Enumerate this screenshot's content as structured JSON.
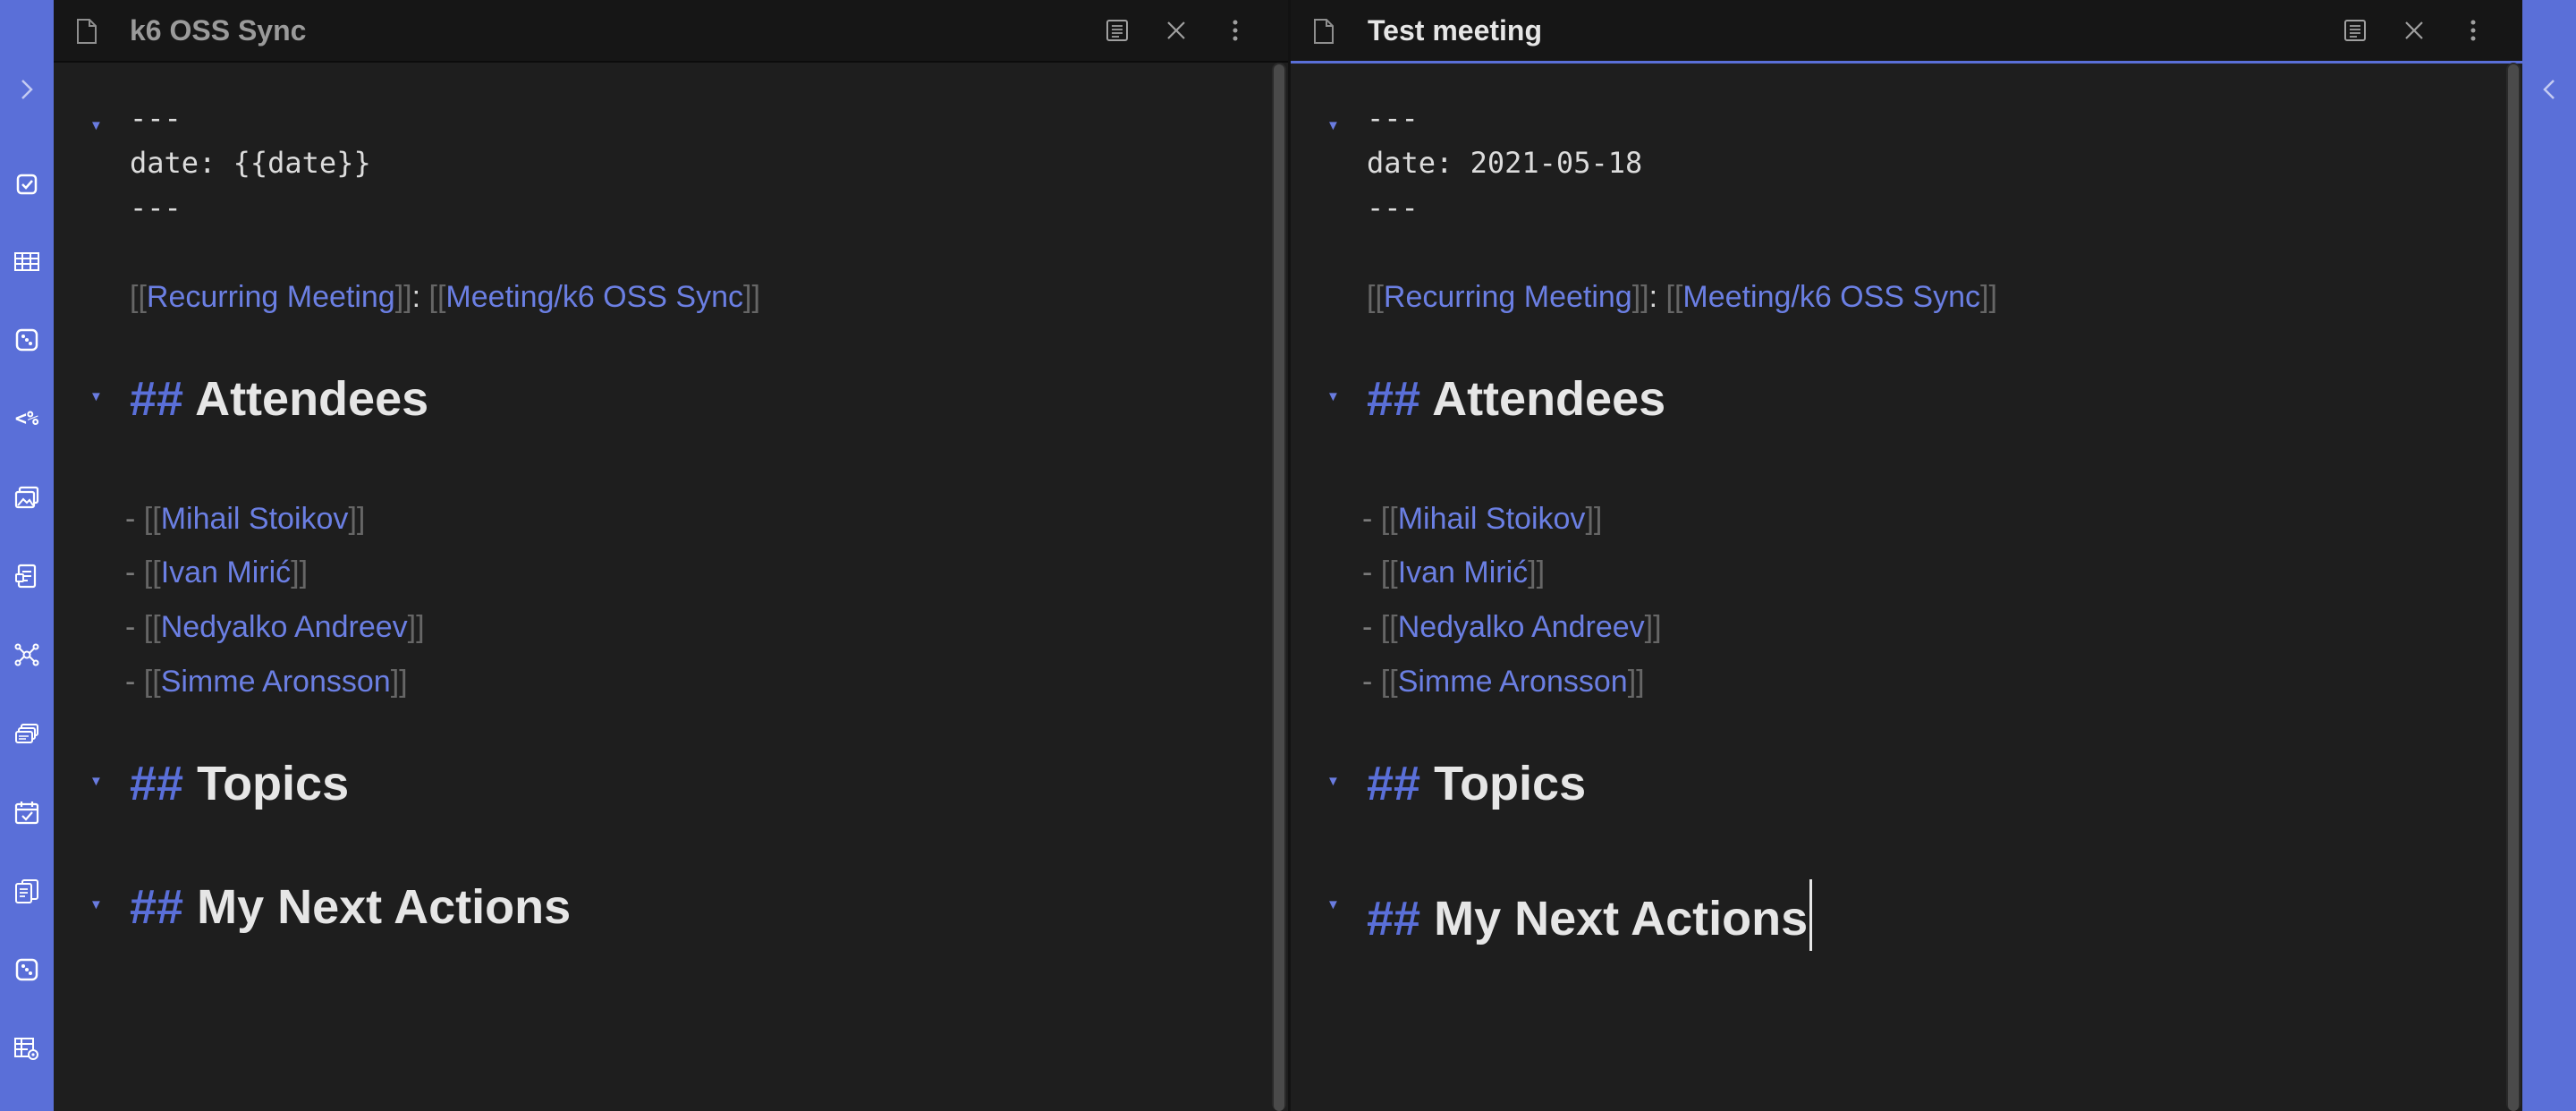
{
  "ribbon": {
    "accent": "#5a6fd8",
    "left_collapse_icon": "chevron-right-icon",
    "right_collapse_icon": "chevron-left-icon",
    "icons": [
      "checkbox-icon",
      "table-icon",
      "dice-icon",
      "templater-icon",
      "gallery-icon",
      "form-icon",
      "graph-icon",
      "cards-icon",
      "calendar-check-icon",
      "copy-document-icon",
      "dice-icon",
      "table-settings-icon"
    ],
    "templater_label": "<%"
  },
  "panes": [
    {
      "title": "k6 OSS Sync",
      "frontmatter": {
        "open": "---",
        "date_line": "date: {{date}}",
        "close": "---"
      },
      "meta": {
        "open_bracket": "[[",
        "close_bracket": "]]",
        "separator": ": ",
        "link1": "Recurring Meeting",
        "link2": "Meeting/k6 OSS Sync"
      },
      "attendees_heading": {
        "hashes": "##",
        "text": "Attendees"
      },
      "attendees": [
        {
          "dash": "- ",
          "open": "[[",
          "name": "Mihail Stoikov",
          "close": "]]"
        },
        {
          "dash": "- ",
          "open": "[[",
          "name": "Ivan Mirić",
          "close": "]]"
        },
        {
          "dash": "- ",
          "open": "[[",
          "name": "Nedyalko Andreev",
          "close": "]]"
        },
        {
          "dash": "- ",
          "open": "[[",
          "name": "Simme Aronsson",
          "close": "]]"
        }
      ],
      "topics_heading": {
        "hashes": "##",
        "text": "Topics"
      },
      "actions_heading": {
        "hashes": "##",
        "text": "My Next Actions"
      }
    },
    {
      "title": "Test meeting",
      "frontmatter": {
        "open": "---",
        "date_line": "date: 2021-05-18",
        "close": "---"
      },
      "meta": {
        "open_bracket": "[[",
        "close_bracket": "]]",
        "separator": ": ",
        "link1": "Recurring Meeting",
        "link2": "Meeting/k6 OSS Sync"
      },
      "attendees_heading": {
        "hashes": "##",
        "text": "Attendees"
      },
      "attendees": [
        {
          "dash": "- ",
          "open": "[[",
          "name": "Mihail Stoikov",
          "close": "]]"
        },
        {
          "dash": "- ",
          "open": "[[",
          "name": "Ivan Mirić",
          "close": "]]"
        },
        {
          "dash": "- ",
          "open": "[[",
          "name": "Nedyalko Andreev",
          "close": "]]"
        },
        {
          "dash": "- ",
          "open": "[[",
          "name": "Simme Aronsson",
          "close": "]]"
        }
      ],
      "topics_heading": {
        "hashes": "##",
        "text": "Topics"
      },
      "actions_heading": {
        "hashes": "##",
        "text": "My Next Actions"
      }
    }
  ]
}
